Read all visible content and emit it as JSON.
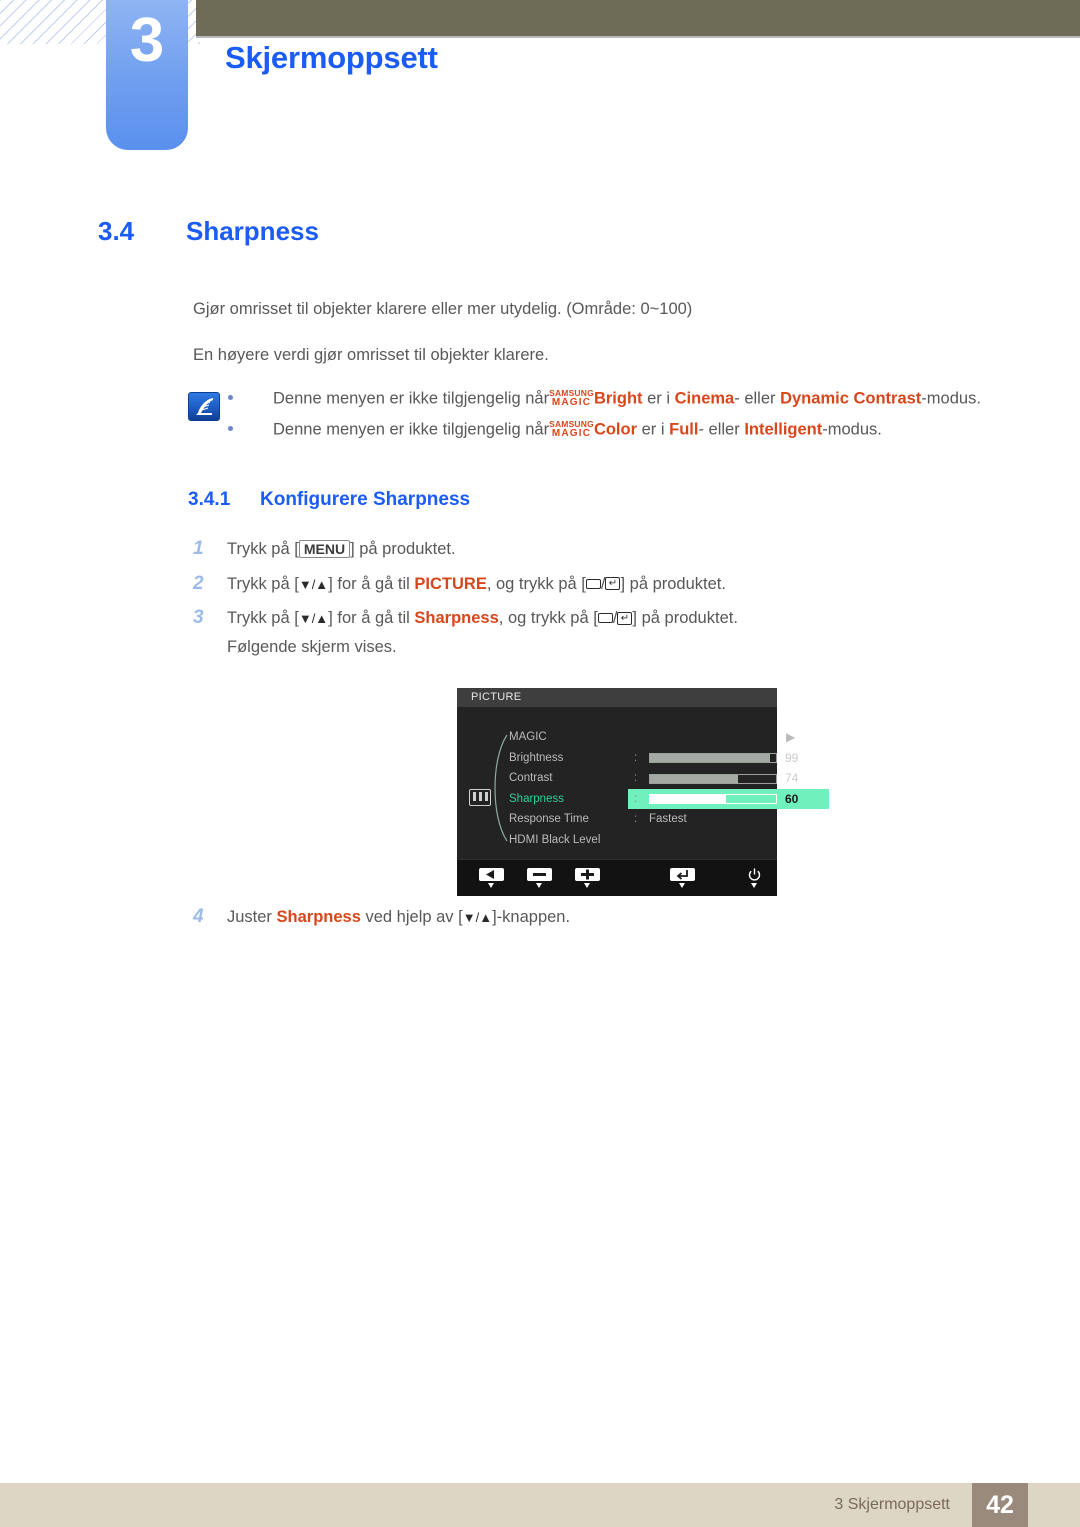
{
  "header": {
    "chapter_number": "3",
    "chapter_title": "Skjermoppsett"
  },
  "section": {
    "number": "3.4",
    "title": "Sharpness"
  },
  "paragraphs": {
    "p1": "Gjør omrisset til objekter klarere eller mer utydelig. (Område: 0~100)",
    "p2": "En høyere verdi gjør omrisset til objekter klarere."
  },
  "note": {
    "icon": "note-pen-icon",
    "bullets": [
      {
        "prefix": "Denne menyen er ikke tilgjengelig når",
        "magic_top": "SAMSUNG",
        "magic_bottom": "MAGIC",
        "feature": "Bright",
        "mid": "er i",
        "value1": "Cinema",
        "sep1": "- eller",
        "value2": "Dynamic Contrast",
        "suffix": "-modus."
      },
      {
        "prefix": "Denne menyen er ikke tilgjengelig når",
        "magic_top": "SAMSUNG",
        "magic_bottom": "MAGIC",
        "feature": "Color",
        "mid": "er i",
        "value1": "Full",
        "sep1": "- eller",
        "value2": "Intelligent",
        "suffix": "-modus."
      }
    ]
  },
  "subsection": {
    "number": "3.4.1",
    "title": "Konfigurere Sharpness"
  },
  "steps": [
    {
      "num": "1",
      "pre": "Trykk på [",
      "key": "MENU",
      "post": "] på produktet."
    },
    {
      "num": "2",
      "pre": "Trykk på [",
      "arrows": "▼/▲",
      "mid": "] for å gå til",
      "target": "PICTURE",
      "mid2": ", og trykk på [",
      "btn_a": "rect-icon",
      "slash": "/",
      "btn_b": "enter-icon",
      "post": "] på produktet."
    },
    {
      "num": "3",
      "pre": "Trykk på [",
      "arrows": "▼/▲",
      "mid": "] for å gå til",
      "target": "Sharpness",
      "mid2": ", og trykk på [",
      "btn_a": "rect-icon",
      "slash": "/",
      "btn_b": "enter-icon",
      "post": "] på produktet."
    }
  ],
  "substep_text": "Følgende skjerm vises.",
  "step4": {
    "num": "4",
    "pre": "Juster",
    "target": "Sharpness",
    "mid": "ved hjelp av [",
    "arrows": "▼/▲",
    "post": "]-knappen."
  },
  "osd": {
    "title": "PICTURE",
    "left_icon": "picture-mode-icon",
    "rows": [
      {
        "label": "MAGIC",
        "type": "arrow",
        "arrow": "▶"
      },
      {
        "label": "Brightness",
        "type": "bar",
        "colon": ":",
        "value": "99",
        "percent": 99
      },
      {
        "label": "Contrast",
        "type": "bar",
        "colon": ":",
        "value": "74",
        "percent": 74
      },
      {
        "label": "Sharpness",
        "type": "bar",
        "colon": ":",
        "value": "60",
        "percent": 60,
        "selected": true
      },
      {
        "label": "Response Time",
        "type": "text",
        "colon": ":",
        "value": "Fastest"
      },
      {
        "label": "HDMI Black Level",
        "type": "plain"
      }
    ],
    "footer_buttons": [
      {
        "name": "back-button",
        "glyph": "◀"
      },
      {
        "name": "minus-button",
        "glyph": "▬"
      },
      {
        "name": "plus-button",
        "glyph": "✚"
      },
      {
        "name": "enter-button",
        "glyph": "↵"
      },
      {
        "name": "power-button",
        "glyph": "⏻"
      }
    ]
  },
  "footer": {
    "text": "3 Skjermoppsett",
    "page": "42"
  },
  "colors": {
    "accent_blue": "#1a5cf5",
    "highlight_red": "#d8471b",
    "olive": "#6e6b57",
    "footer_band": "#ddd6c4",
    "page_box": "#9a8a7c",
    "osd_green": "#6ff0bd"
  }
}
